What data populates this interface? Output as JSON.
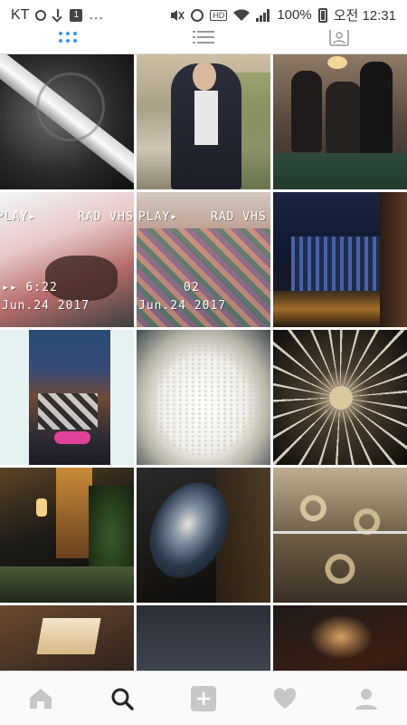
{
  "status_bar": {
    "carrier": "KT",
    "left_icons": [
      "record-icon",
      "download-icon",
      "app-notification-icon",
      "more-notifications-icon"
    ],
    "more_label": "...",
    "right_icons": [
      "mute-icon",
      "alarm-icon",
      "hd-icon",
      "wifi-icon",
      "signal-icon"
    ],
    "hd_label": "HD",
    "battery_percent": "100%",
    "clock": "오전 12:31"
  },
  "profile_tabs": {
    "items": [
      {
        "name": "grid",
        "icon": "grid-icon",
        "active": true
      },
      {
        "name": "list",
        "icon": "list-icon",
        "active": false
      },
      {
        "name": "tagged",
        "icon": "tagged-person-icon",
        "active": false
      }
    ],
    "active_color": "#3897f0"
  },
  "grid_posts": [
    {
      "id": 1,
      "overlay": []
    },
    {
      "id": 2,
      "overlay": []
    },
    {
      "id": 3,
      "overlay": []
    },
    {
      "id": 4,
      "overlay": [
        "PLAY▸",
        "RAD VHS",
        "▸▸ 6:22",
        "Jun.24 2017"
      ]
    },
    {
      "id": 5,
      "overlay": [
        "PLAY▸",
        "RAD VHS",
        "02",
        "Jun.24 2017"
      ]
    },
    {
      "id": 6,
      "overlay": []
    },
    {
      "id": 7,
      "overlay": []
    },
    {
      "id": 8,
      "overlay": []
    },
    {
      "id": 9,
      "overlay": []
    },
    {
      "id": 10,
      "overlay": []
    },
    {
      "id": 11,
      "overlay": []
    },
    {
      "id": 12,
      "overlay": []
    },
    {
      "id": 13,
      "overlay": []
    },
    {
      "id": 14,
      "overlay": []
    },
    {
      "id": 15,
      "overlay": []
    }
  ],
  "bottom_nav": {
    "items": [
      "home-icon",
      "search-icon",
      "add-post-icon",
      "activity-heart-icon",
      "profile-icon"
    ],
    "active": "search-icon",
    "inactive_color": "#c7c7c7",
    "active_color": "#262626"
  }
}
